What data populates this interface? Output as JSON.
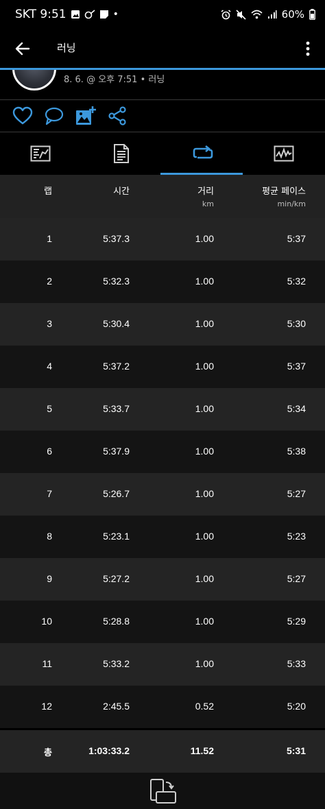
{
  "status_bar": {
    "carrier_time": "SKT 9:51",
    "battery": "60%"
  },
  "app_bar": {
    "title": "러닝"
  },
  "activity": {
    "subtitle": "8. 6. @ 오후 7:51 • 러닝"
  },
  "tabs": [
    {
      "icon": "summary-icon"
    },
    {
      "icon": "details-icon"
    },
    {
      "icon": "laps-icon",
      "selected": true
    },
    {
      "icon": "graph-icon"
    }
  ],
  "table": {
    "headers": {
      "lap": "랩",
      "time": "시간",
      "distance": "거리",
      "distance_unit": "km",
      "pace": "평균 페이스",
      "pace_unit": "min/km"
    },
    "rows": [
      {
        "lap": "1",
        "time": "5:37.3",
        "distance": "1.00",
        "pace": "5:37"
      },
      {
        "lap": "2",
        "time": "5:32.3",
        "distance": "1.00",
        "pace": "5:32"
      },
      {
        "lap": "3",
        "time": "5:30.4",
        "distance": "1.00",
        "pace": "5:30"
      },
      {
        "lap": "4",
        "time": "5:37.2",
        "distance": "1.00",
        "pace": "5:37"
      },
      {
        "lap": "5",
        "time": "5:33.7",
        "distance": "1.00",
        "pace": "5:34"
      },
      {
        "lap": "6",
        "time": "5:37.9",
        "distance": "1.00",
        "pace": "5:38"
      },
      {
        "lap": "7",
        "time": "5:26.7",
        "distance": "1.00",
        "pace": "5:27"
      },
      {
        "lap": "8",
        "time": "5:23.1",
        "distance": "1.00",
        "pace": "5:23"
      },
      {
        "lap": "9",
        "time": "5:27.2",
        "distance": "1.00",
        "pace": "5:27"
      },
      {
        "lap": "10",
        "time": "5:28.8",
        "distance": "1.00",
        "pace": "5:29"
      },
      {
        "lap": "11",
        "time": "5:33.2",
        "distance": "1.00",
        "pace": "5:33"
      },
      {
        "lap": "12",
        "time": "2:45.5",
        "distance": "0.52",
        "pace": "5:20"
      }
    ],
    "total": {
      "lap": "총",
      "time": "1:03:33.2",
      "distance": "11.52",
      "pace": "5:31"
    }
  },
  "colors": {
    "accent": "#3c98dc",
    "row_light": "#242424",
    "row_dark": "#141414"
  }
}
